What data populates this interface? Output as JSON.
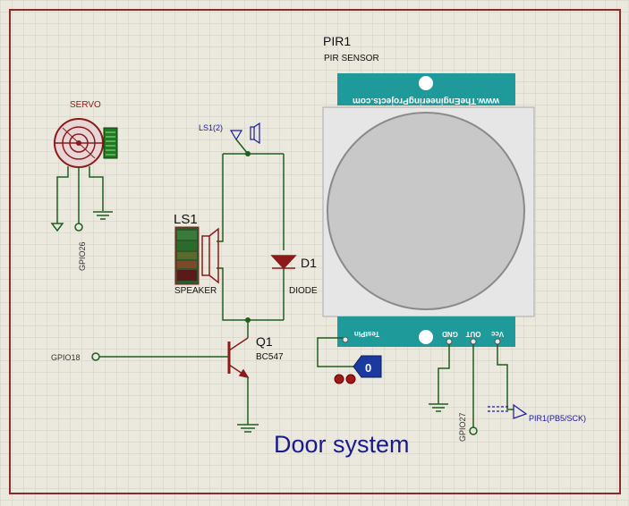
{
  "title": "Door system",
  "components": {
    "pir": {
      "ref": "PIR1",
      "type": "PIR SENSOR",
      "banner": "www.TheEngineeringProjects.com",
      "pins": [
        "TestPin",
        "GND",
        "OUT",
        "Vcc"
      ],
      "logic_state": "0"
    },
    "servo": {
      "label": "SERVO"
    },
    "speaker": {
      "ref": "LS1",
      "type": "SPEAKER",
      "terminal": "LS1(2)"
    },
    "diode": {
      "ref": "D1",
      "type": "DIODE"
    },
    "transistor": {
      "ref": "Q1",
      "type": "BC547"
    }
  },
  "nets": {
    "gpio26": "GPIO26",
    "gpio18": "GPIO18",
    "gpio27": "GPIO27",
    "pir_signal": "PIR1(PB5/SCK)"
  },
  "colors": {
    "background": "#ebe8dd",
    "grid": "#d2cfc4",
    "border": "#8b2a2a",
    "wire": "#1f5e1f",
    "component": "#8b1a1a",
    "terminal_blue": "#1a1aa0",
    "pir_teal": "#1e9a9a",
    "pir_lens": "#c8c8c8"
  }
}
